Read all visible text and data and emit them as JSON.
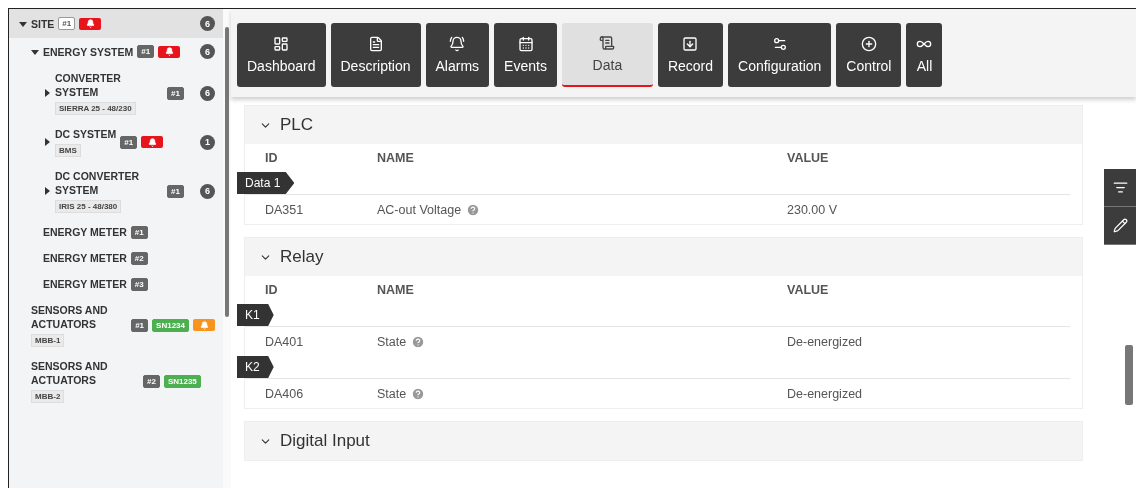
{
  "tree": [
    {
      "label": "SITE",
      "badge": "#1",
      "color": "#e8141c",
      "count": "6",
      "selected": true,
      "expanded": true,
      "children": [
        {
          "label": "ENERGY SYSTEM",
          "badge": "#1",
          "color": "#e8141c",
          "count": "6",
          "selected": false,
          "expanded": true,
          "children": [
            {
              "label": "CONVERTER SYSTEM",
              "tag": "SIERRA 25 - 48/230",
              "badge": "#1",
              "count": "6",
              "selected": false,
              "expanded": false
            },
            {
              "label": "DC SYSTEM",
              "tag": "BMS",
              "badge": "#1",
              "color": "#e8141c",
              "count": "1",
              "selected": false,
              "expanded": false
            },
            {
              "label": "DC CONVERTER SYSTEM",
              "tag": "IRIS 25 - 48/380",
              "badge": "#1",
              "count": "6",
              "selected": false,
              "expanded": false
            },
            {
              "label": "ENERGY METER",
              "badge": "#1",
              "selected": false
            },
            {
              "label": "ENERGY METER",
              "badge": "#2",
              "selected": false
            },
            {
              "label": "ENERGY METER",
              "badge": "#3",
              "selected": false
            }
          ]
        },
        {
          "label": "SENSORS AND ACTUATORS",
          "tag": "MBB-1",
          "badge": "#1",
          "serial": "SN1234",
          "color": "#f7941d",
          "selected": false
        },
        {
          "label": "SENSORS AND ACTUATORS",
          "tag": "MBB-2",
          "badge": "#2",
          "serial": "SN1235",
          "selected": false
        }
      ]
    }
  ],
  "tabs": [
    {
      "label": "Dashboard",
      "selected": false
    },
    {
      "label": "Description",
      "selected": false
    },
    {
      "label": "Alarms",
      "selected": false
    },
    {
      "label": "Events",
      "selected": false
    },
    {
      "label": "Data",
      "selected": true
    },
    {
      "label": "Record",
      "selected": false
    },
    {
      "label": "Configuration",
      "selected": false
    },
    {
      "label": "Control",
      "selected": false
    },
    {
      "label": "All",
      "selected": false
    }
  ],
  "sections": [
    {
      "title": "PLC",
      "expanded": true,
      "columns": [
        "ID",
        "NAME",
        "VALUE"
      ],
      "groups": [
        {
          "label": "Data 1",
          "rows": [
            {
              "id": "DA351",
              "name": "AC-out Voltage",
              "value": "230.00 V"
            }
          ]
        }
      ]
    },
    {
      "title": "Relay",
      "expanded": true,
      "columns": [
        "ID",
        "NAME",
        "VALUE"
      ],
      "groups": [
        {
          "label": "K1",
          "rows": [
            {
              "id": "DA401",
              "name": "State",
              "value": "De-energized"
            }
          ]
        },
        {
          "label": "K2",
          "rows": [
            {
              "id": "DA406",
              "name": "State",
              "value": "De-energized"
            }
          ]
        }
      ]
    },
    {
      "title": "Digital Input",
      "expanded": true
    }
  ]
}
